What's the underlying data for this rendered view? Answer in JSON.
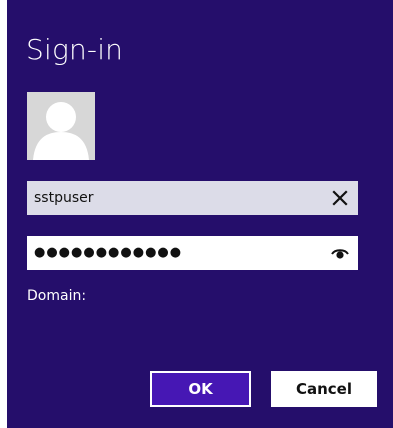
{
  "dialog": {
    "title": "Sign-in",
    "background_color": "#250e6b",
    "avatar_icon": "user-silhouette-icon"
  },
  "username": {
    "value": "sstpuser",
    "clear_icon": "close-icon"
  },
  "password": {
    "masked_value": "●●●●●●●●●●●●",
    "reveal_icon": "eye-icon"
  },
  "domain": {
    "label": "Domain:"
  },
  "buttons": {
    "ok_label": "OK",
    "cancel_label": "Cancel",
    "ok_color": "#4617b4"
  }
}
